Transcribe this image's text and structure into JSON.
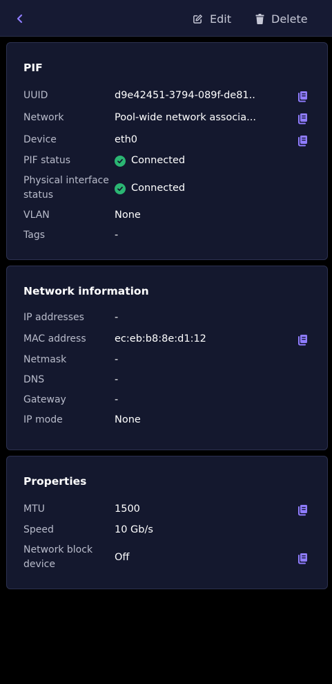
{
  "header": {
    "back_icon": "chevron-left-icon",
    "edit_label": "Edit",
    "edit_icon": "pencil-square-icon",
    "delete_label": "Delete",
    "delete_icon": "trash-icon"
  },
  "colors": {
    "background": "#000000",
    "card": "#14182e",
    "accent": "#8f7cff",
    "success": "#2bb673"
  },
  "pif": {
    "title": "PIF",
    "rows": [
      {
        "label": "UUID",
        "value": "d9e42451-3794-089f-de81...",
        "copy": true
      },
      {
        "label": "Network",
        "value": "Pool-wide network associa...",
        "copy": true
      },
      {
        "label": "Device",
        "value": "eth0",
        "copy": true
      },
      {
        "label": "PIF status",
        "value": "Connected",
        "status_icon": "check-circle-icon"
      },
      {
        "label": "Physical interface status",
        "value": "Connected",
        "status_icon": "check-circle-icon"
      },
      {
        "label": "VLAN",
        "value": "None"
      },
      {
        "label": "Tags",
        "value": "-"
      }
    ]
  },
  "network_info": {
    "title": "Network information",
    "rows": [
      {
        "label": "IP addresses",
        "value": "-"
      },
      {
        "label": "MAC address",
        "value": "ec:eb:b8:8e:d1:12",
        "copy": true
      },
      {
        "label": "Netmask",
        "value": "-"
      },
      {
        "label": "DNS",
        "value": "-"
      },
      {
        "label": "Gateway",
        "value": "-"
      },
      {
        "label": "IP mode",
        "value": "None"
      }
    ]
  },
  "properties": {
    "title": "Properties",
    "rows": [
      {
        "label": "MTU",
        "value": "1500",
        "copy": true
      },
      {
        "label": "Speed",
        "value": "10 Gb/s"
      },
      {
        "label": "Network block device",
        "value": "Off",
        "copy": true
      }
    ]
  }
}
